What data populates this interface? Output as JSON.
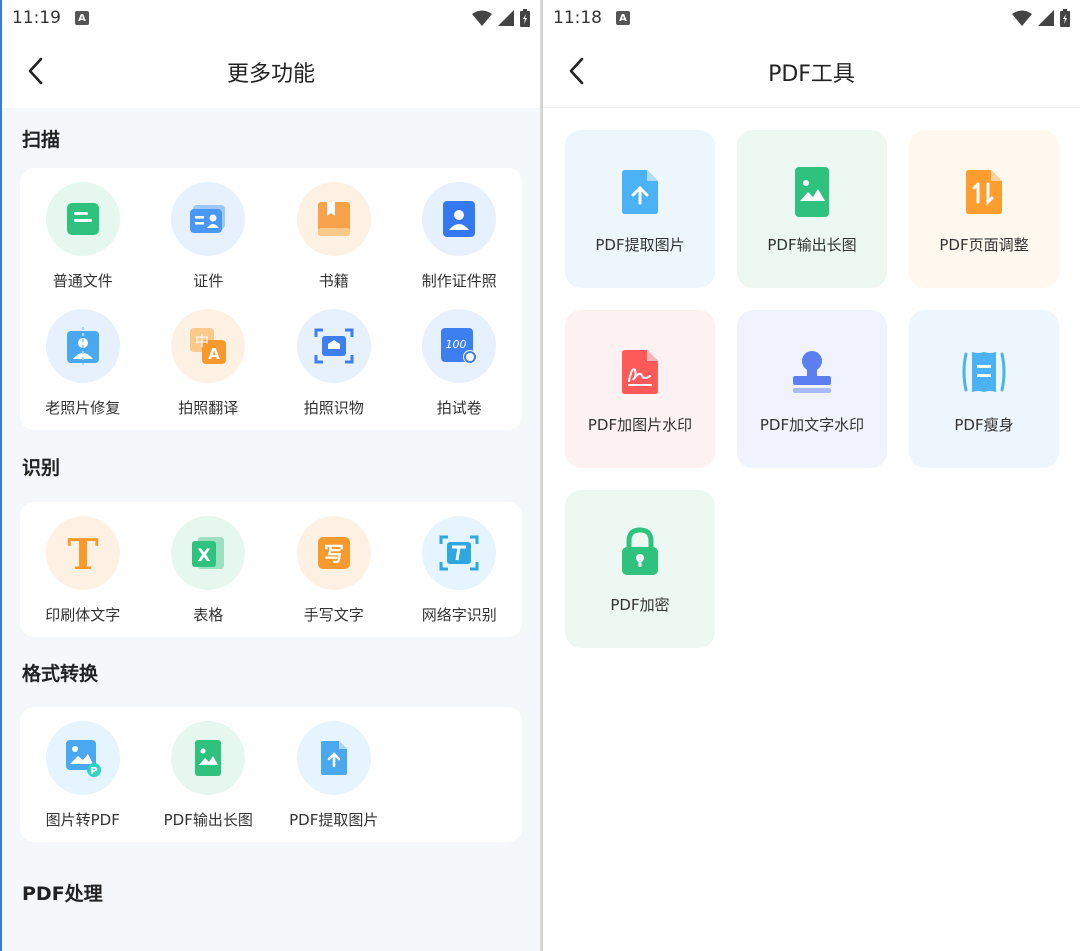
{
  "left": {
    "status_time": "11:19",
    "title": "更多功能",
    "sections": [
      {
        "title": "扫描",
        "items": [
          "普通文件",
          "证件",
          "书籍",
          "制作证件照",
          "老照片修复",
          "拍照翻译",
          "拍照识物",
          "拍试卷"
        ]
      },
      {
        "title": "识别",
        "items": [
          "印刷体文字",
          "表格",
          "手写文字",
          "网络字识别"
        ]
      },
      {
        "title": "格式转换",
        "items": [
          "图片转PDF",
          "PDF输出长图",
          "PDF提取图片"
        ]
      },
      {
        "title": "PDF处理"
      }
    ],
    "icon_glyphs": {
      "translate_a": "A",
      "translate_zh": "中",
      "paper_score": "100",
      "print_t": "T",
      "excel_x": "X",
      "write_char": "写"
    }
  },
  "right": {
    "status_time": "11:18",
    "title": "PDF工具",
    "tools": [
      "PDF提取图片",
      "PDF输出长图",
      "PDF页面调整",
      "PDF加图片水印",
      "PDF加文字水印",
      "PDF瘦身",
      "PDF加密"
    ]
  },
  "colors": {
    "accent": "#3a7bd5",
    "green": "#2ec27e",
    "orange": "#ff9d2e",
    "blue": "#3d8ef0",
    "red": "#ff5a5a"
  }
}
